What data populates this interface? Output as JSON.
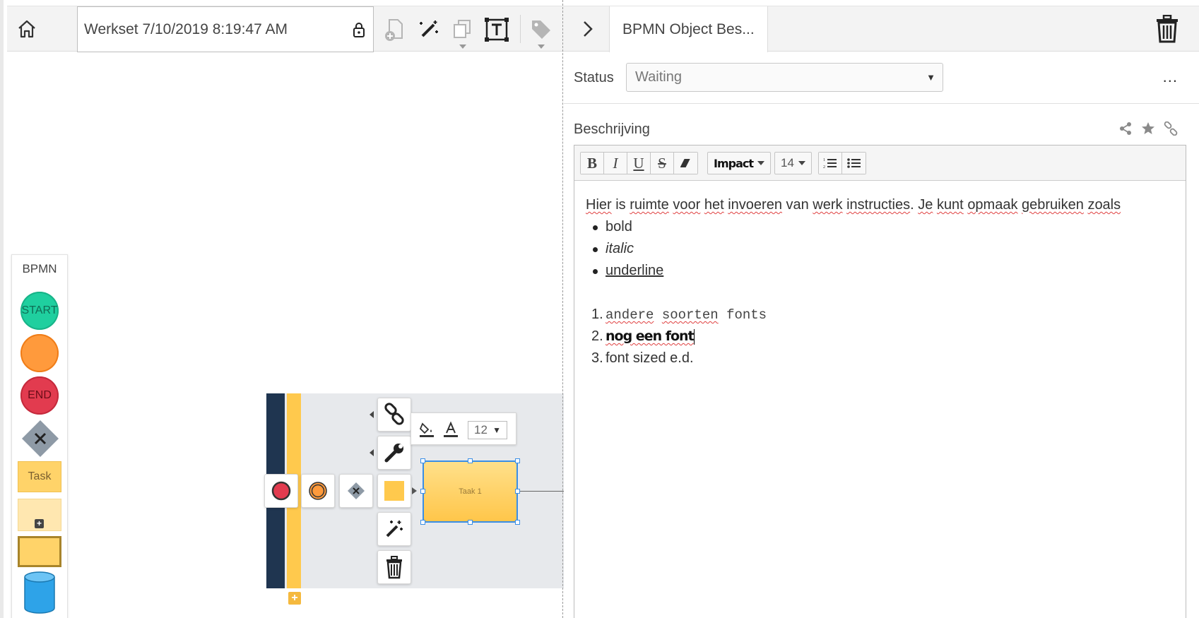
{
  "left_panel": {
    "werkset_title": "Werkset 7/10/2019 8:19:47 AM",
    "palette": {
      "title": "BPMN",
      "start_label": "START",
      "end_label": "END",
      "task_label": "Task"
    },
    "canvas": {
      "font_size_value": "12",
      "task_label": "Taak 1"
    }
  },
  "right_panel": {
    "tab_label": "BPMN Object Bes...",
    "status_label": "Status",
    "status_value": "Waiting",
    "more_label": "...",
    "description_label": "Beschrijving",
    "editor": {
      "toolbar": {
        "font_name": "Impact",
        "font_size": "14"
      },
      "content": {
        "intro": {
          "w1": "Hier",
          "w2": " is ",
          "w3": "ruimte",
          "w4": " ",
          "w5": "voor",
          "w6": " ",
          "w7": "het",
          "w8": " ",
          "w9": "invoeren",
          "w10": " van ",
          "w11": "werk",
          "w12": " ",
          "w13": "instructies",
          "w14": ". ",
          "w15": "Je",
          "w16": " ",
          "w17": "kunt",
          "w18": " ",
          "w19": "opmaak",
          "w20": " ",
          "w21": "gebruiken",
          "w22": " ",
          "w23": "zoals"
        },
        "bullets": [
          "bold",
          "italic",
          "underline"
        ],
        "numbered": {
          "item1_a": "andere",
          "item1_b": "soorten",
          "item1_c": "fonts",
          "item2": "nog een font",
          "item3": "font sized e.d."
        },
        "numbers": [
          "1.",
          "2.",
          "3."
        ]
      }
    }
  },
  "colors": {
    "start": "#1fcf9f",
    "intermediate": "#ff9a3c",
    "end": "#e23b4f",
    "gateway": "#8e9aa6",
    "task": "#ffd369",
    "lane_dark": "#1f3550",
    "selection": "#3a8ee6"
  }
}
